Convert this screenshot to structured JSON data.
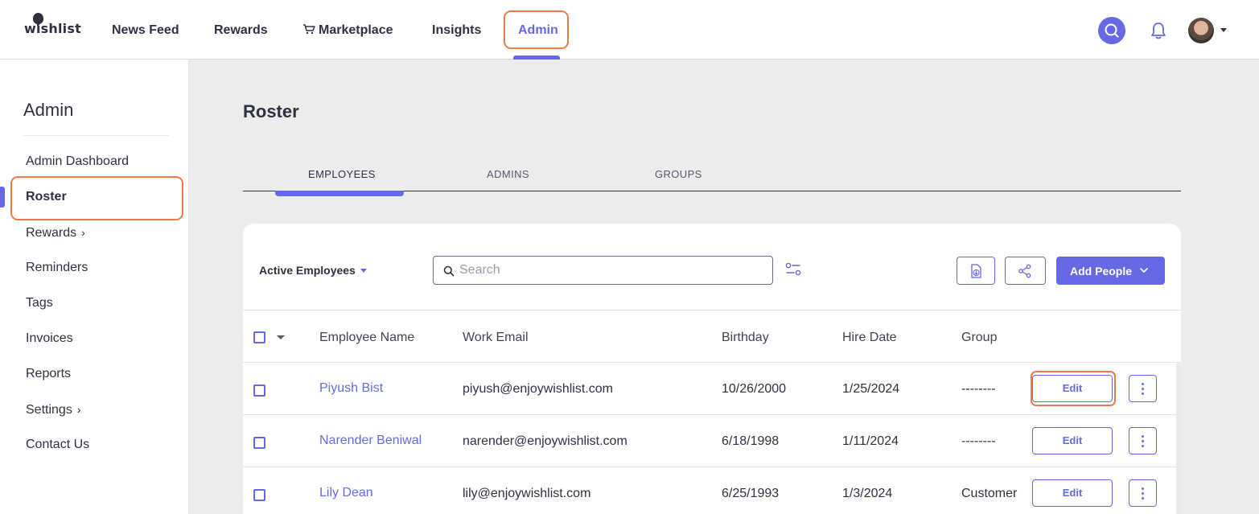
{
  "nav": {
    "logo": "wishlist",
    "items": [
      {
        "label": "News Feed"
      },
      {
        "label": "Rewards"
      },
      {
        "label": "Marketplace"
      },
      {
        "label": "Insights"
      },
      {
        "label": "Admin"
      }
    ],
    "active": "Admin",
    "icons": [
      "search-icon",
      "bell-icon",
      "avatar",
      "chevron-down-icon",
      "cart-icon"
    ]
  },
  "sidebar": {
    "title": "Admin",
    "items": [
      {
        "label": "Admin Dashboard"
      },
      {
        "label": "Roster"
      },
      {
        "label": "Rewards"
      },
      {
        "label": "Reminders"
      },
      {
        "label": "Tags"
      },
      {
        "label": "Invoices"
      },
      {
        "label": "Reports"
      },
      {
        "label": "Settings"
      },
      {
        "label": "Contact Us"
      }
    ],
    "active": "Roster"
  },
  "page": {
    "title": "Roster",
    "tabs": [
      {
        "label": "EMPLOYEES"
      },
      {
        "label": "ADMINS"
      },
      {
        "label": "GROUPS"
      }
    ],
    "active_tab": "EMPLOYEES"
  },
  "toolbar": {
    "filter_label": "Active Employees",
    "search_placeholder": "Search",
    "add_people_label": "Add People"
  },
  "table": {
    "columns": [
      "Employee Name",
      "Work Email",
      "Birthday",
      "Hire Date",
      "Group"
    ],
    "rows": [
      {
        "name": "Piyush Bist",
        "email": "piyush@enjoywishlist.com",
        "birthday": "10/26/2000",
        "hire_date": "1/25/2024",
        "group": "--------",
        "action": "Edit"
      },
      {
        "name": "Narender Beniwal",
        "email": "narender@enjoywishlist.com",
        "birthday": "6/18/1998",
        "hire_date": "1/11/2024",
        "group": "--------",
        "action": "Edit"
      },
      {
        "name": "Lily Dean",
        "email": "lily@enjoywishlist.com",
        "birthday": "6/25/1993",
        "hire_date": "1/3/2024",
        "group": "Customer",
        "action": "Edit"
      }
    ]
  },
  "colors": {
    "accent": "#6669e3",
    "highlight": "#ee7a4a",
    "text": "#2d3142",
    "background": "#ececed"
  }
}
